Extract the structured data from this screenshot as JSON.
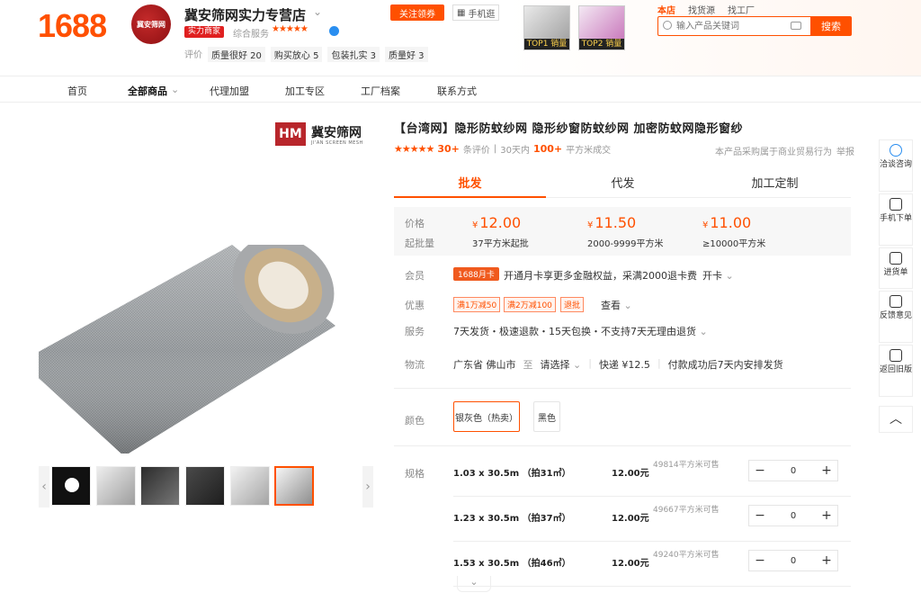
{
  "header": {
    "logo": "1688",
    "shop_avatar_text": "冀安筛网",
    "shop_name": "冀安筛网实力专营店",
    "badge_power": "实力商家",
    "service_label": "综合服务",
    "shop_stars": "★★★★★",
    "eval_label": "评价",
    "eval_tags": [
      "质量很好 20",
      "购买放心 5",
      "包装扎实 3",
      "质量好 3"
    ],
    "follow_label": "关注领券",
    "mobile_label": "手机逛",
    "top_products": [
      "TOP1 销量",
      "TOP2 销量"
    ],
    "search_tabs": [
      "本店",
      "找货源",
      "找工厂"
    ],
    "search_placeholder": "输入产品关键词",
    "search_button": "搜索"
  },
  "nav": {
    "items": [
      "首页",
      "全部商品",
      "代理加盟",
      "加工专区",
      "工厂档案",
      "联系方式"
    ]
  },
  "brand": {
    "mark": "HM",
    "name": "冀安筛网",
    "sub": "JI'AN SCREEN MESH"
  },
  "product": {
    "title": "【台湾网】隐形防蚊纱网 隐形纱窗防蚊纱网 加密防蚊网隐形窗纱",
    "stars": "★★★★★",
    "review_count": "30+",
    "review_label": "条评价",
    "sales_prefix": "30天内",
    "sales_count": "100+",
    "sales_suffix": "平方米成交",
    "biz_note": "本产品采购属于商业贸易行为",
    "report": "举报",
    "tabs": [
      "批发",
      "代发",
      "加工定制"
    ],
    "price_label": "价格",
    "qty_label": "起批量",
    "tiers": [
      {
        "price": "12.00",
        "qty": "37平方米起批"
      },
      {
        "price": "11.50",
        "qty": "2000-9999平方米"
      },
      {
        "price": "11.00",
        "qty": "≥10000平方米"
      }
    ],
    "currency": "¥",
    "member_label": "会员",
    "member_tag": "1688月卡",
    "member_text": "开通月卡享更多金融权益，采满2000退卡费",
    "member_card": "开卡",
    "discount_label": "优惠",
    "coupons": [
      "满1万减50",
      "满2万减100",
      "退批"
    ],
    "coupon_more": "查看",
    "service_label": "服务",
    "service_text": "7天发货・极速退款・15天包换・不支持7天无理由退货",
    "logistics_label": "物流",
    "logistics_from": "广东省 佛山市",
    "logistics_to_label": "至",
    "logistics_to": "请选择",
    "logistics_express": "快递 ¥12.5",
    "logistics_note": "付款成功后7天内安排发货",
    "color_label": "颜色",
    "colors": [
      "银灰色（热卖）",
      "黑色"
    ],
    "spec_label": "规格",
    "specs": [
      {
        "name": "1.03 x 30.5m （拍31㎡）",
        "price": "12.00元",
        "stock": "49814平方米可售",
        "qty": "0"
      },
      {
        "name": "1.23 x 30.5m （拍37㎡）",
        "price": "12.00元",
        "stock": "49667平方米可售",
        "qty": "0"
      },
      {
        "name": "1.53 x 30.5m （拍46㎡）",
        "price": "12.00元",
        "stock": "49240平方米可售",
        "qty": "0"
      }
    ]
  },
  "sidebar": {
    "items": [
      "洽谈咨询",
      "手机下单",
      "进货单",
      "反馈意见",
      "返回旧版"
    ]
  },
  "colors": {
    "accent": "#ff5000",
    "power_badge": "#e02020"
  }
}
